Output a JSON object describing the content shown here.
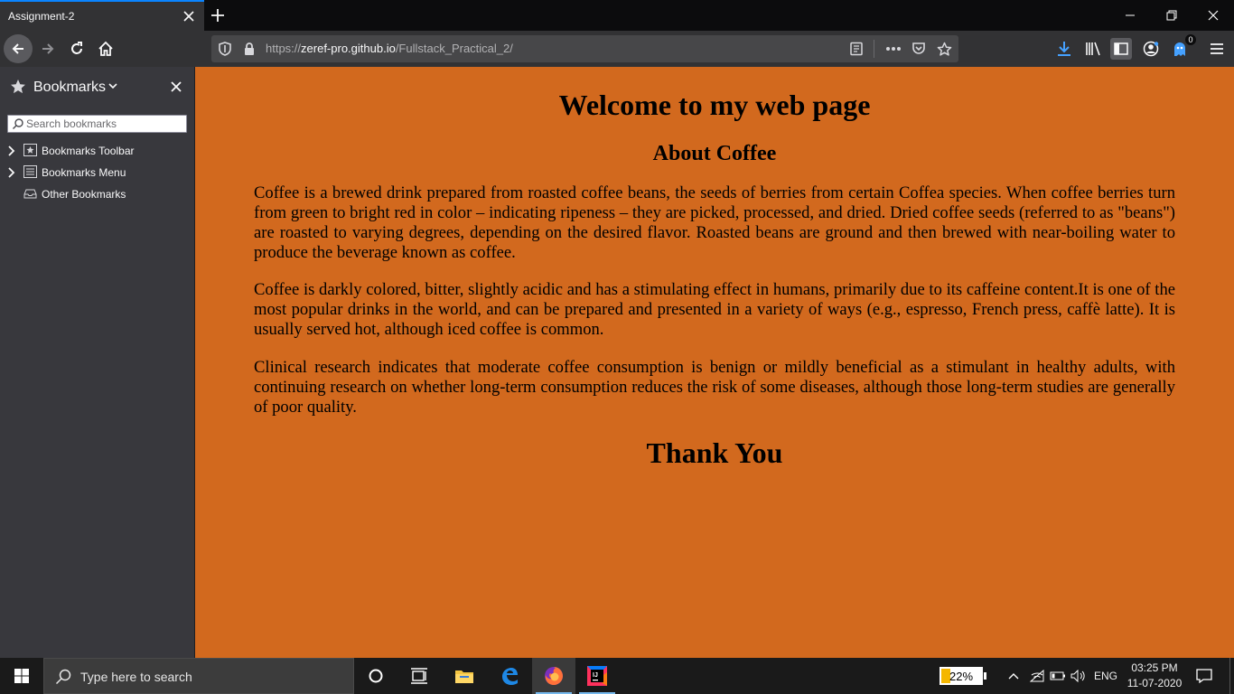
{
  "browser": {
    "tab": {
      "title": "Assignment-2"
    },
    "url": {
      "prefix": "https://",
      "host": "zeref-pro.github.io",
      "path": "/Fullstack_Practical_2/"
    },
    "notification_count": "0"
  },
  "sidebar": {
    "title": "Bookmarks",
    "search_placeholder": "Search bookmarks",
    "items": [
      {
        "label": "Bookmarks Toolbar",
        "icon": "bookmarks-toolbar-icon",
        "expandable": true
      },
      {
        "label": "Bookmarks Menu",
        "icon": "bookmarks-menu-icon",
        "expandable": true
      },
      {
        "label": "Other Bookmarks",
        "icon": "other-bookmarks-icon",
        "expandable": false
      }
    ]
  },
  "page": {
    "heading": "Welcome to my web page",
    "subheading": "About Coffee",
    "paragraphs": [
      "Coffee is a brewed drink prepared from roasted coffee beans, the seeds of berries from certain Coffea species. When coffee berries turn from green to bright red in color – indicating ripeness – they are picked, processed, and dried. Dried coffee seeds (referred to as \"beans\") are roasted to varying degrees, depending on the desired flavor. Roasted beans are ground and then brewed with near-boiling water to produce the beverage known as coffee.",
      "Coffee is darkly colored, bitter, slightly acidic and has a stimulating effect in humans, primarily due to its caffeine content.It is one of the most popular drinks in the world, and can be prepared and presented in a variety of ways (e.g., espresso, French press, caffè latte). It is usually served hot, although iced coffee is common.",
      "Clinical research indicates that moderate coffee consumption is benign or mildly beneficial as a stimulant in healthy adults, with continuing research on whether long-term consumption reduces the risk of some diseases, although those long-term studies are generally of poor quality."
    ],
    "footer": "Thank You",
    "background_color": "#d2691e"
  },
  "taskbar": {
    "search_placeholder": "Type here to search",
    "battery_percent": 22,
    "battery_label": "22%",
    "language": "ENG",
    "time": "03:25 PM",
    "date": "11-07-2020",
    "apps": [
      "cortana-icon",
      "task-view-icon",
      "file-explorer-icon",
      "edge-icon",
      "firefox-icon",
      "intellij-icon"
    ]
  },
  "colors": {
    "accent": "#0a84ff",
    "toolbar": "#323234",
    "sidebar": "#38383d",
    "battery": "#f5b700"
  }
}
